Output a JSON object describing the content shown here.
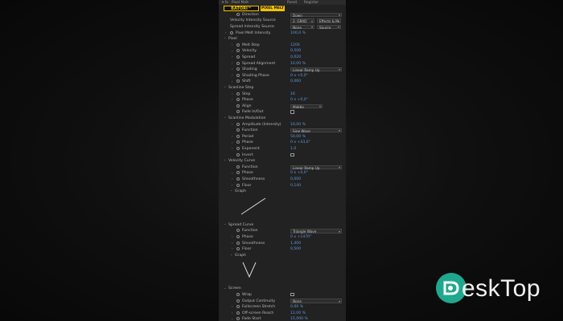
{
  "topbar": {
    "effect": "Pixel Melt",
    "reset": "Reset",
    "register": "Register"
  },
  "logo": {
    "brand": "BATORI™",
    "product": "PIXEL MELT"
  },
  "rows": [
    {
      "kind": "dropdown",
      "label": "Direction",
      "value": "Down",
      "indent": 1,
      "stopwatch": true
    },
    {
      "kind": "dropdown2",
      "label": "Velocity Intensity Source",
      "value": "2. GRAD",
      "value2": "Effects & M",
      "indent": 0
    },
    {
      "kind": "dropdown2",
      "label": "Spread Intensity Source",
      "value": "None",
      "value2": "Source",
      "indent": 0
    },
    {
      "kind": "value",
      "label": "Pixel Melt Intensity",
      "value": "100,0 %",
      "indent": 0,
      "twirl": true,
      "stopwatch": true
    },
    {
      "kind": "group",
      "label": "Pixel",
      "indent": 0
    },
    {
      "kind": "value",
      "label": "Melt Step",
      "value": "1200",
      "indent": 1,
      "twirl": true,
      "stopwatch": true
    },
    {
      "kind": "value",
      "label": "Velocity",
      "value": "0,500",
      "indent": 1,
      "twirl": true,
      "stopwatch": true
    },
    {
      "kind": "value",
      "label": "Spread",
      "value": "0,020",
      "indent": 1,
      "twirl": true,
      "stopwatch": true
    },
    {
      "kind": "value",
      "label": "Spread Alignment",
      "value": "10,00 %",
      "indent": 1,
      "twirl": true,
      "stopwatch": true
    },
    {
      "kind": "dropdown",
      "label": "Shading",
      "value": "Linear Ramp Up",
      "indent": 1,
      "twirl": true,
      "stopwatch": true
    },
    {
      "kind": "value",
      "label": "Shading Phase",
      "value": "0 x +0,0°",
      "indent": 1,
      "twirl": true,
      "stopwatch": true
    },
    {
      "kind": "value",
      "label": "Shift",
      "value": "0,060",
      "indent": 1,
      "twirl": true,
      "stopwatch": true
    },
    {
      "kind": "group",
      "label": "Scanline Step",
      "indent": 0
    },
    {
      "kind": "value",
      "label": "Step",
      "value": "16",
      "indent": 1,
      "twirl": true,
      "stopwatch": true
    },
    {
      "kind": "value",
      "label": "Phase",
      "value": "0 x +0,0°",
      "indent": 1,
      "twirl": true,
      "stopwatch": true
    },
    {
      "kind": "dropdown-small",
      "label": "Align",
      "value": "Middle",
      "indent": 1,
      "stopwatch": true
    },
    {
      "kind": "checkbox",
      "label": "Fade In/Out",
      "indent": 1,
      "stopwatch": true
    },
    {
      "kind": "group",
      "label": "Scanline Modulation",
      "indent": 0
    },
    {
      "kind": "value",
      "label": "Amplitude (Intensity)",
      "value": "10,00 %",
      "indent": 1,
      "twirl": true,
      "stopwatch": true
    },
    {
      "kind": "dropdown",
      "label": "Function",
      "value": "Sine Wave",
      "indent": 1,
      "stopwatch": true
    },
    {
      "kind": "value",
      "label": "Period",
      "value": "50,00 %",
      "indent": 1,
      "twirl": true,
      "stopwatch": true
    },
    {
      "kind": "value",
      "label": "Phase",
      "value": "0 x +43,0°",
      "indent": 1,
      "twirl": true,
      "stopwatch": true
    },
    {
      "kind": "value",
      "label": "Exponent",
      "value": "1,0",
      "indent": 1,
      "twirl": true,
      "stopwatch": true
    },
    {
      "kind": "checkbox",
      "label": "Invert",
      "indent": 1,
      "stopwatch": true
    },
    {
      "kind": "group",
      "label": "Velocity Curve",
      "indent": 0
    },
    {
      "kind": "dropdown",
      "label": "Function",
      "value": "Linear Ramp Up",
      "indent": 1,
      "stopwatch": true
    },
    {
      "kind": "value",
      "label": "Phase",
      "value": "0 x +0,0°",
      "indent": 1,
      "twirl": true,
      "stopwatch": true
    },
    {
      "kind": "value",
      "label": "Smoothness",
      "value": "0,000",
      "indent": 1,
      "twirl": true,
      "stopwatch": true
    },
    {
      "kind": "value",
      "label": "Floor",
      "value": "0,140",
      "indent": 1,
      "twirl": true,
      "stopwatch": true
    },
    {
      "kind": "group",
      "label": "Graph",
      "indent": 1
    },
    {
      "kind": "graph",
      "shape": "ramp"
    },
    {
      "kind": "group",
      "label": "Spread Curve",
      "indent": 0
    },
    {
      "kind": "dropdown",
      "label": "Function",
      "value": "Triangle Wave",
      "indent": 1,
      "stopwatch": true
    },
    {
      "kind": "value",
      "label": "Phase",
      "value": "0 x +1470°",
      "indent": 1,
      "twirl": true,
      "stopwatch": true
    },
    {
      "kind": "value",
      "label": "Smoothness",
      "value": "1,400",
      "indent": 1,
      "twirl": true,
      "stopwatch": true
    },
    {
      "kind": "value",
      "label": "Floor",
      "value": "0,500",
      "indent": 1,
      "twirl": true,
      "stopwatch": true
    },
    {
      "kind": "group",
      "label": "Graph",
      "indent": 1
    },
    {
      "kind": "graph",
      "shape": "vee"
    },
    {
      "kind": "group",
      "label": "Screen",
      "indent": 0
    },
    {
      "kind": "checkbox",
      "label": "Wrap",
      "indent": 1,
      "stopwatch": true
    },
    {
      "kind": "dropdown",
      "label": "Output Continuity",
      "value": "None",
      "indent": 1,
      "stopwatch": true
    },
    {
      "kind": "value",
      "label": "Fullscreen Stretch",
      "value": "0,00 %",
      "indent": 1,
      "twirl": true,
      "stopwatch": true
    },
    {
      "kind": "value",
      "label": "Off-screen Reach",
      "value": "12,00 %",
      "indent": 1,
      "twirl": true,
      "stopwatch": true
    },
    {
      "kind": "value",
      "label": "Fade Start",
      "value": "15,000 %",
      "indent": 1,
      "twirl": true,
      "stopwatch": true
    },
    {
      "kind": "value",
      "label": "Fade End",
      "value": "19,000 %",
      "indent": 1,
      "twirl": true,
      "stopwatch": true
    }
  ],
  "watermark": {
    "text": "eskTop",
    "accent": "#1fa88d"
  },
  "colors": {
    "value_blue": "#5c9ae0",
    "logo_yellow": "#f2c200",
    "panel_bg": "#222222"
  }
}
